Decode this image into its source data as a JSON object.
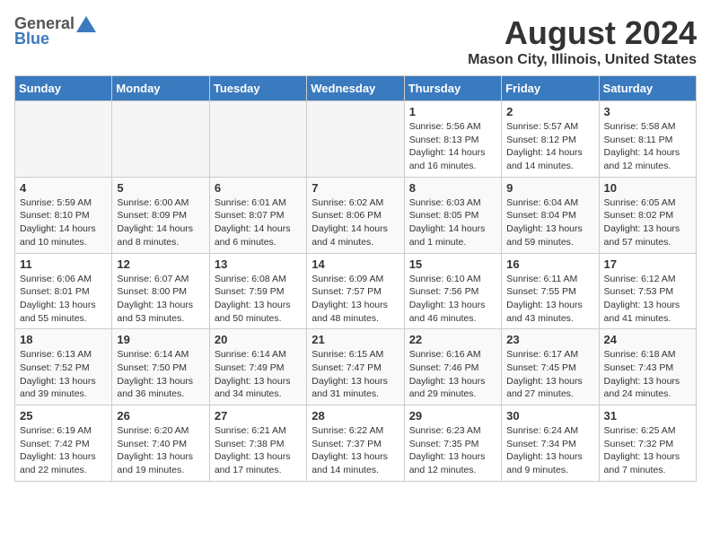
{
  "header": {
    "logo_general": "General",
    "logo_blue": "Blue",
    "main_title": "August 2024",
    "sub_title": "Mason City, Illinois, United States"
  },
  "calendar": {
    "days_of_week": [
      "Sunday",
      "Monday",
      "Tuesday",
      "Wednesday",
      "Thursday",
      "Friday",
      "Saturday"
    ],
    "weeks": [
      {
        "days": [
          {
            "number": "",
            "empty": true
          },
          {
            "number": "",
            "empty": true
          },
          {
            "number": "",
            "empty": true
          },
          {
            "number": "",
            "empty": true
          },
          {
            "number": "1",
            "sunrise": "5:56 AM",
            "sunset": "8:13 PM",
            "daylight": "14 hours and 16 minutes."
          },
          {
            "number": "2",
            "sunrise": "5:57 AM",
            "sunset": "8:12 PM",
            "daylight": "14 hours and 14 minutes."
          },
          {
            "number": "3",
            "sunrise": "5:58 AM",
            "sunset": "8:11 PM",
            "daylight": "14 hours and 12 minutes."
          }
        ]
      },
      {
        "days": [
          {
            "number": "4",
            "sunrise": "5:59 AM",
            "sunset": "8:10 PM",
            "daylight": "14 hours and 10 minutes."
          },
          {
            "number": "5",
            "sunrise": "6:00 AM",
            "sunset": "8:09 PM",
            "daylight": "14 hours and 8 minutes."
          },
          {
            "number": "6",
            "sunrise": "6:01 AM",
            "sunset": "8:07 PM",
            "daylight": "14 hours and 6 minutes."
          },
          {
            "number": "7",
            "sunrise": "6:02 AM",
            "sunset": "8:06 PM",
            "daylight": "14 hours and 4 minutes."
          },
          {
            "number": "8",
            "sunrise": "6:03 AM",
            "sunset": "8:05 PM",
            "daylight": "14 hours and 1 minute."
          },
          {
            "number": "9",
            "sunrise": "6:04 AM",
            "sunset": "8:04 PM",
            "daylight": "13 hours and 59 minutes."
          },
          {
            "number": "10",
            "sunrise": "6:05 AM",
            "sunset": "8:02 PM",
            "daylight": "13 hours and 57 minutes."
          }
        ]
      },
      {
        "days": [
          {
            "number": "11",
            "sunrise": "6:06 AM",
            "sunset": "8:01 PM",
            "daylight": "13 hours and 55 minutes."
          },
          {
            "number": "12",
            "sunrise": "6:07 AM",
            "sunset": "8:00 PM",
            "daylight": "13 hours and 53 minutes."
          },
          {
            "number": "13",
            "sunrise": "6:08 AM",
            "sunset": "7:59 PM",
            "daylight": "13 hours and 50 minutes."
          },
          {
            "number": "14",
            "sunrise": "6:09 AM",
            "sunset": "7:57 PM",
            "daylight": "13 hours and 48 minutes."
          },
          {
            "number": "15",
            "sunrise": "6:10 AM",
            "sunset": "7:56 PM",
            "daylight": "13 hours and 46 minutes."
          },
          {
            "number": "16",
            "sunrise": "6:11 AM",
            "sunset": "7:55 PM",
            "daylight": "13 hours and 43 minutes."
          },
          {
            "number": "17",
            "sunrise": "6:12 AM",
            "sunset": "7:53 PM",
            "daylight": "13 hours and 41 minutes."
          }
        ]
      },
      {
        "days": [
          {
            "number": "18",
            "sunrise": "6:13 AM",
            "sunset": "7:52 PM",
            "daylight": "13 hours and 39 minutes."
          },
          {
            "number": "19",
            "sunrise": "6:14 AM",
            "sunset": "7:50 PM",
            "daylight": "13 hours and 36 minutes."
          },
          {
            "number": "20",
            "sunrise": "6:14 AM",
            "sunset": "7:49 PM",
            "daylight": "13 hours and 34 minutes."
          },
          {
            "number": "21",
            "sunrise": "6:15 AM",
            "sunset": "7:47 PM",
            "daylight": "13 hours and 31 minutes."
          },
          {
            "number": "22",
            "sunrise": "6:16 AM",
            "sunset": "7:46 PM",
            "daylight": "13 hours and 29 minutes."
          },
          {
            "number": "23",
            "sunrise": "6:17 AM",
            "sunset": "7:45 PM",
            "daylight": "13 hours and 27 minutes."
          },
          {
            "number": "24",
            "sunrise": "6:18 AM",
            "sunset": "7:43 PM",
            "daylight": "13 hours and 24 minutes."
          }
        ]
      },
      {
        "days": [
          {
            "number": "25",
            "sunrise": "6:19 AM",
            "sunset": "7:42 PM",
            "daylight": "13 hours and 22 minutes."
          },
          {
            "number": "26",
            "sunrise": "6:20 AM",
            "sunset": "7:40 PM",
            "daylight": "13 hours and 19 minutes."
          },
          {
            "number": "27",
            "sunrise": "6:21 AM",
            "sunset": "7:38 PM",
            "daylight": "13 hours and 17 minutes."
          },
          {
            "number": "28",
            "sunrise": "6:22 AM",
            "sunset": "7:37 PM",
            "daylight": "13 hours and 14 minutes."
          },
          {
            "number": "29",
            "sunrise": "6:23 AM",
            "sunset": "7:35 PM",
            "daylight": "13 hours and 12 minutes."
          },
          {
            "number": "30",
            "sunrise": "6:24 AM",
            "sunset": "7:34 PM",
            "daylight": "13 hours and 9 minutes."
          },
          {
            "number": "31",
            "sunrise": "6:25 AM",
            "sunset": "7:32 PM",
            "daylight": "13 hours and 7 minutes."
          }
        ]
      }
    ],
    "labels": {
      "sunrise": "Sunrise:",
      "sunset": "Sunset:",
      "daylight": "Daylight:"
    }
  }
}
